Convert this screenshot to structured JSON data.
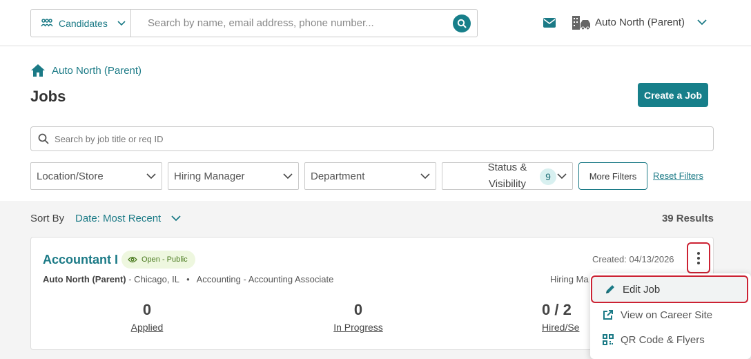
{
  "topbar": {
    "candidate_select_label": "Candidates",
    "search_placeholder": "Search by name, email address, phone number...",
    "org_name": "Auto North (Parent)"
  },
  "breadcrumb": {
    "label": "Auto North (Parent)"
  },
  "page": {
    "title": "Jobs",
    "create_button": "Create a Job",
    "job_search_placeholder": "Search by job title or req ID"
  },
  "filters": {
    "location": "Location/Store",
    "hiring_manager": "Hiring Manager",
    "department": "Department",
    "status_line1": "Status &",
    "status_line2": "Visibility",
    "status_count": "9",
    "more_filters": "More Filters",
    "reset_filters": "Reset Filters"
  },
  "results": {
    "sort_by_label": "Sort By",
    "sort_value": "Date: Most Recent",
    "count": "39 Results"
  },
  "job_card": {
    "title": "Accountant I",
    "status": "Open - Public",
    "created": "Created: 04/13/2026",
    "org": "Auto North (Parent)",
    "location": "- Chicago, IL",
    "dept": "Accounting",
    "role": "- Accounting Associate",
    "hiring_manager_partial": "Hiring Ma",
    "stats": [
      {
        "num": "0",
        "label": "Applied"
      },
      {
        "num": "0",
        "label": "In Progress"
      },
      {
        "num": "0 / 2",
        "label": "Hired/Se"
      }
    ]
  },
  "menu": {
    "items": [
      {
        "label": "Edit Job",
        "icon": "pencil-icon"
      },
      {
        "label": "View on Career Site",
        "icon": "external-link-icon"
      },
      {
        "label": "QR Code & Flyers",
        "icon": "qr-code-icon"
      }
    ]
  },
  "colors": {
    "accent": "#177f8a",
    "highlight_border": "#cc2233",
    "status_green": "#4a7a1f"
  }
}
